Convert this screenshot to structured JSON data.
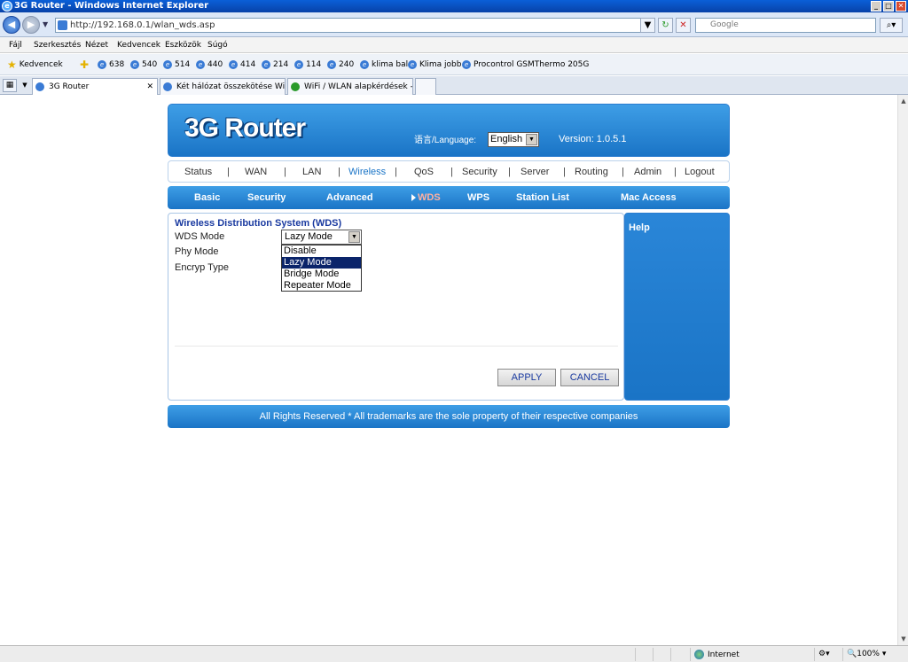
{
  "window": {
    "title": "3G Router - Windows Internet Explorer"
  },
  "address": {
    "url": "http://192.168.0.1/wlan_wds.asp",
    "search_placeholder": "Google"
  },
  "menu": [
    "Fájl",
    "Szerkesztés",
    "Nézet",
    "Kedvencek",
    "Eszközök",
    "Súgó"
  ],
  "favorites": {
    "label": "Kedvencek",
    "items": [
      "638",
      "540",
      "514",
      "440",
      "414",
      "214",
      "114",
      "240",
      "klima bal",
      "Klima jobb",
      "Procontrol GSMThermo 205G"
    ]
  },
  "tabs": [
    "3G Router",
    "Két hálózat összekötése WiF...",
    "WiFi / WLAN alapkérdések - ..."
  ],
  "status": {
    "zone": "Internet",
    "zoom": "100%"
  },
  "router": {
    "logo": "3G Router",
    "language_label": "语言/Language:",
    "language_value": "English",
    "version": "Version: 1.0.5.1",
    "main_nav": [
      "Status",
      "WAN",
      "LAN",
      "Wireless",
      "QoS",
      "Security",
      "Server",
      "Routing",
      "Admin",
      "Logout"
    ],
    "sub_nav": [
      "Basic",
      "Security",
      "Advanced",
      "WDS",
      "WPS",
      "Station List",
      "Mac Access"
    ],
    "section_title": "Wireless Distribution System (WDS)",
    "labels": {
      "wds_mode": "WDS Mode",
      "phy_mode": "Phy Mode",
      "encryp_type": "Encryp Type"
    },
    "wds_mode_value": "Lazy Mode",
    "wds_options": [
      "Disable",
      "Lazy Mode",
      "Bridge Mode",
      "Repeater Mode"
    ],
    "apply": "APPLY",
    "cancel": "CANCEL",
    "help": "Help",
    "footer": "All Rights Reserved * All trademarks are the sole property of their respective companies"
  }
}
